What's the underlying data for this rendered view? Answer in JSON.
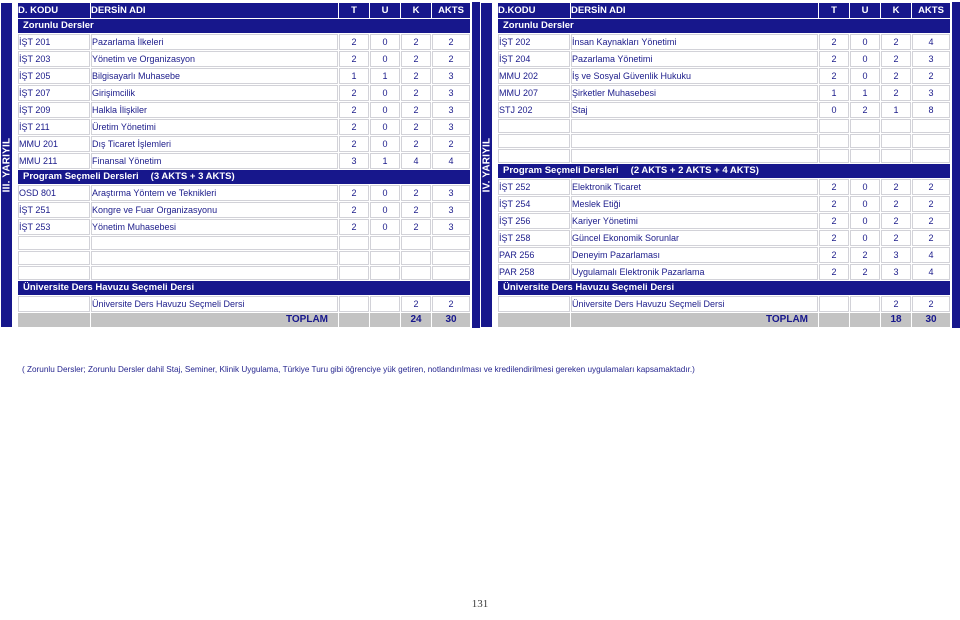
{
  "page": {
    "number": "131",
    "footnote": "( Zorunlu Dersler; Zorunlu Dersler dahil Staj, Seminer, Klinik Uygulama, Türkiye Turu gibi öğrenciye yük getiren, notlandırılması ve kredilendirilmesi gereken uygulamaları  kapsamaktadır.)"
  },
  "colors": {
    "navy": "#17178c",
    "gray": "#c3c3c3",
    "white": "#ffffff",
    "text_navy": "#1b1b8a"
  },
  "semesters": [
    {
      "id": "sem3",
      "spine_label": "III. YARIYIL",
      "headers": {
        "code": "D. KODU",
        "name": "DERSİN ADI",
        "t": "T",
        "u": "U",
        "k": "K",
        "akts": "AKTS"
      },
      "sections": [
        {
          "band": "Zorunlu  Dersler",
          "band_note": "",
          "rows": [
            {
              "code": "İŞT 201",
              "name": "Pazarlama İlkeleri",
              "t": "2",
              "u": "0",
              "k": "2",
              "akts": "2"
            },
            {
              "code": "İŞT 203",
              "name": "Yönetim ve Organizasyon",
              "t": "2",
              "u": "0",
              "k": "2",
              "akts": "2"
            },
            {
              "code": "İŞT 205",
              "name": "Bilgisayarlı Muhasebe",
              "t": "1",
              "u": "1",
              "k": "2",
              "akts": "3"
            },
            {
              "code": "İŞT 207",
              "name": "Girişimcilik",
              "t": "2",
              "u": "0",
              "k": "2",
              "akts": "3"
            },
            {
              "code": "İŞT 209",
              "name": "Halkla İlişkiler",
              "t": "2",
              "u": "0",
              "k": "2",
              "akts": "3"
            },
            {
              "code": "İŞT 211",
              "name": "Üretim Yönetimi",
              "t": "2",
              "u": "0",
              "k": "2",
              "akts": "3"
            },
            {
              "code": "MMU 201",
              "name": "Dış Ticaret İşlemleri",
              "t": "2",
              "u": "0",
              "k": "2",
              "akts": "2"
            },
            {
              "code": "MMU 211",
              "name": "Finansal Yönetim",
              "t": "3",
              "u": "1",
              "k": "4",
              "akts": "4"
            }
          ]
        },
        {
          "band": "Program Seçmeli Dersleri",
          "band_note": "(3 AKTS + 3 AKTS)",
          "rows": [
            {
              "code": "OSD 801",
              "name": "Araştırma Yöntem ve Teknikleri",
              "t": "2",
              "u": "0",
              "k": "2",
              "akts": "3"
            },
            {
              "code": "İŞT 251",
              "name": "Kongre ve Fuar Organizasyonu",
              "t": "2",
              "u": "0",
              "k": "2",
              "akts": "3"
            },
            {
              "code": "İŞT 253",
              "name": "Yönetim Muhasebesi",
              "t": "2",
              "u": "0",
              "k": "2",
              "akts": "3"
            },
            {
              "code": "",
              "name": "",
              "t": "",
              "u": "",
              "k": "",
              "akts": ""
            },
            {
              "code": "",
              "name": "",
              "t": "",
              "u": "",
              "k": "",
              "akts": ""
            },
            {
              "code": "",
              "name": "",
              "t": "",
              "u": "",
              "k": "",
              "akts": ""
            }
          ]
        },
        {
          "band": "Üniversite Ders Havuzu Seçmeli  Dersi",
          "band_note": "",
          "rows": [
            {
              "code": "",
              "name": "Üniversite Ders Havuzu Seçmeli  Dersi",
              "indent": true,
              "t": "",
              "u": "",
              "k": "2",
              "akts": "2"
            }
          ]
        }
      ],
      "total": {
        "label": "TOPLAM",
        "t": "",
        "u": "",
        "k": "24",
        "akts": "30"
      }
    },
    {
      "id": "sem4",
      "spine_label": "IV. YARIYIL",
      "headers": {
        "code": "D.KODU",
        "name": "DERSİN ADI",
        "t": "T",
        "u": "U",
        "k": "K",
        "akts": "AKTS"
      },
      "sections": [
        {
          "band": "Zorunlu  Dersler",
          "band_note": "",
          "rows": [
            {
              "code": "İŞT 202",
              "name": "İnsan Kaynakları Yönetimi",
              "t": "2",
              "u": "0",
              "k": "2",
              "akts": "4"
            },
            {
              "code": "İŞT 204",
              "name": "Pazarlama Yönetimi",
              "t": "2",
              "u": "0",
              "k": "2",
              "akts": "3"
            },
            {
              "code": "MMU 202",
              "name": "İş ve Sosyal Güvenlik Hukuku",
              "t": "2",
              "u": "0",
              "k": "2",
              "akts": "2"
            },
            {
              "code": "MMU 207",
              "name": "Şirketler Muhasebesi",
              "t": "1",
              "u": "1",
              "k": "2",
              "akts": "3"
            },
            {
              "code": "STJ 202",
              "name": "Staj",
              "t": "0",
              "u": "2",
              "k": "1",
              "akts": "8"
            },
            {
              "code": "",
              "name": "",
              "t": "",
              "u": "",
              "k": "",
              "akts": ""
            },
            {
              "code": "",
              "name": "",
              "t": "",
              "u": "",
              "k": "",
              "akts": ""
            },
            {
              "code": "",
              "name": "",
              "t": "",
              "u": "",
              "k": "",
              "akts": ""
            }
          ]
        },
        {
          "band": "Program Seçmeli Dersleri",
          "band_note": "(2 AKTS + 2 AKTS + 4 AKTS)",
          "rows": [
            {
              "code": "İŞT 252",
              "name": "Elektronik Ticaret",
              "t": "2",
              "u": "0",
              "k": "2",
              "akts": "2"
            },
            {
              "code": "İŞT 254",
              "name": "Meslek Etiği",
              "t": "2",
              "u": "0",
              "k": "2",
              "akts": "2"
            },
            {
              "code": "İŞT 256",
              "name": "Kariyer Yönetimi",
              "t": "2",
              "u": "0",
              "k": "2",
              "akts": "2"
            },
            {
              "code": "İŞT 258",
              "name": "Güncel Ekonomik Sorunlar",
              "t": "2",
              "u": "0",
              "k": "2",
              "akts": "2"
            },
            {
              "code": "PAR 256",
              "name": "Deneyim Pazarlaması",
              "t": "2",
              "u": "2",
              "k": "3",
              "akts": "4"
            },
            {
              "code": "PAR 258",
              "name": "Uygulamalı Elektronik Pazarlama",
              "t": "2",
              "u": "2",
              "k": "3",
              "akts": "4"
            }
          ]
        },
        {
          "band": "Üniversite Ders Havuzu Seçmeli  Dersi",
          "band_note": "",
          "rows": [
            {
              "code": "",
              "name": "Üniversite Ders Havuzu Seçmeli  Dersi",
              "indent": true,
              "t": "",
              "u": "",
              "k": "2",
              "akts": "2"
            }
          ]
        }
      ],
      "total": {
        "label": "TOPLAM",
        "t": "",
        "u": "",
        "k": "18",
        "akts": "30"
      }
    }
  ]
}
